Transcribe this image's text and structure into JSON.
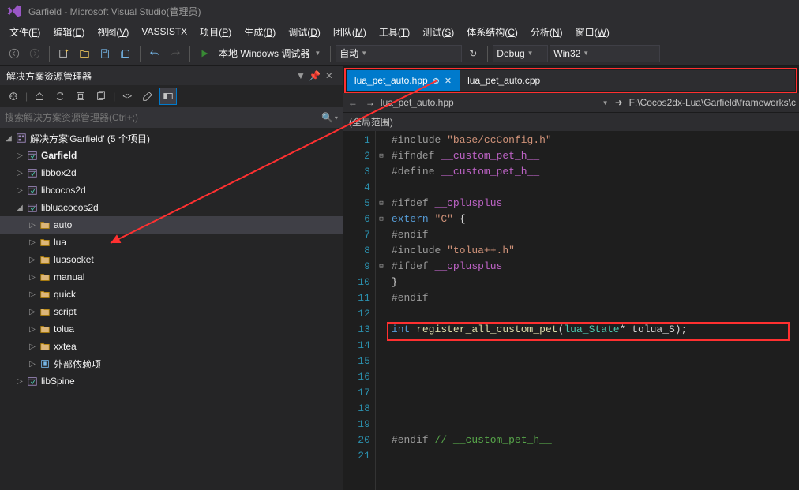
{
  "title": "Garfield - Microsoft Visual Studio(管理员)",
  "menu": [
    "文件(F)",
    "编辑(E)",
    "视图(V)",
    "VASSISTX",
    "项目(P)",
    "生成(B)",
    "调试(D)",
    "团队(M)",
    "工具(T)",
    "测试(S)",
    "体系结构(C)",
    "分析(N)",
    "窗口(W)"
  ],
  "toolbar": {
    "debug_target": "本地 Windows 调试器",
    "solution_config": "自动",
    "config": "Debug",
    "platform": "Win32"
  },
  "solution_explorer": {
    "title": "解决方案资源管理器",
    "search_placeholder": "搜索解决方案资源管理器(Ctrl+;)",
    "root": "解决方案'Garfield' (5 个项目)",
    "items": [
      {
        "label": "Garfield",
        "icon": "proj",
        "bold": true,
        "exp": "▷",
        "indent": 1
      },
      {
        "label": "libbox2d",
        "icon": "proj",
        "exp": "▷",
        "indent": 1
      },
      {
        "label": "libcocos2d",
        "icon": "proj",
        "exp": "▷",
        "indent": 1
      },
      {
        "label": "libluacocos2d",
        "icon": "proj",
        "exp": "◢",
        "indent": 1
      },
      {
        "label": "auto",
        "icon": "folder",
        "exp": "▷",
        "indent": 2,
        "selected": true
      },
      {
        "label": "lua",
        "icon": "folder",
        "exp": "▷",
        "indent": 2
      },
      {
        "label": "luasocket",
        "icon": "folder",
        "exp": "▷",
        "indent": 2
      },
      {
        "label": "manual",
        "icon": "folder",
        "exp": "▷",
        "indent": 2
      },
      {
        "label": "quick",
        "icon": "folder",
        "exp": "▷",
        "indent": 2
      },
      {
        "label": "script",
        "icon": "folder",
        "exp": "▷",
        "indent": 2
      },
      {
        "label": "tolua",
        "icon": "folder",
        "exp": "▷",
        "indent": 2
      },
      {
        "label": "xxtea",
        "icon": "folder",
        "exp": "▷",
        "indent": 2
      },
      {
        "label": "外部依赖项",
        "icon": "ref",
        "exp": "▷",
        "indent": 2
      },
      {
        "label": "libSpine",
        "icon": "proj",
        "exp": "▷",
        "indent": 1
      }
    ]
  },
  "tabs": [
    {
      "label": "lua_pet_auto.hpp",
      "active": true,
      "pinned": true,
      "closeable": true
    },
    {
      "label": "lua_pet_auto.cpp",
      "active": false
    }
  ],
  "nav": {
    "file": "lua_pet_auto.hpp",
    "path": "F:\\Cocos2dx-Lua\\Garfield\\frameworks\\c"
  },
  "scope": "(全局范围)",
  "code": {
    "lines": [
      {
        "n": 1,
        "fold": "",
        "html": "<span class='pp'>#include </span><span class='str'>\"base/ccConfig.h\"</span>"
      },
      {
        "n": 2,
        "fold": "⊟",
        "html": "<span class='pp'>#ifndef </span><span class='mac'>__custom_pet_h__</span>"
      },
      {
        "n": 3,
        "fold": "",
        "html": "<span class='pp'>#define </span><span class='mac'>__custom_pet_h__</span>"
      },
      {
        "n": 4,
        "fold": "",
        "html": ""
      },
      {
        "n": 5,
        "fold": "⊟",
        "html": "<span class='pp'>#ifdef </span><span class='mac'>__cplusplus</span>"
      },
      {
        "n": 6,
        "fold": "⊟",
        "html": "<span class='kw'>extern </span><span class='str'>\"C\"</span><span class='id'> {</span>"
      },
      {
        "n": 7,
        "fold": "",
        "html": "<span class='pp'>#endif</span>"
      },
      {
        "n": 8,
        "fold": "",
        "html": "<span class='pp'>#include </span><span class='str'>\"tolua++.h\"</span>"
      },
      {
        "n": 9,
        "fold": "⊟",
        "html": "<span class='pp'>#ifdef </span><span class='mac'>__cplusplus</span>"
      },
      {
        "n": 10,
        "fold": "",
        "html": "<span class='id'>}</span>"
      },
      {
        "n": 11,
        "fold": "",
        "html": "<span class='pp'>#endif</span>"
      },
      {
        "n": 12,
        "fold": "",
        "html": ""
      },
      {
        "n": 13,
        "fold": "",
        "html": "<span class='kw'>int</span> <span class='fn'>register_all_custom_pet</span><span class='id'>(</span><span class='typ'>lua_State</span><span class='id'>* tolua_S);</span>"
      },
      {
        "n": 14,
        "fold": "",
        "html": ""
      },
      {
        "n": 15,
        "fold": "",
        "html": ""
      },
      {
        "n": 16,
        "fold": "",
        "html": ""
      },
      {
        "n": 17,
        "fold": "",
        "html": ""
      },
      {
        "n": 18,
        "fold": "",
        "html": ""
      },
      {
        "n": 19,
        "fold": "",
        "html": ""
      },
      {
        "n": 20,
        "fold": "",
        "html": "<span class='pp'>#endif </span><span class='cmt'>// __custom_pet_h__</span>"
      },
      {
        "n": 21,
        "fold": "",
        "html": ""
      }
    ]
  }
}
